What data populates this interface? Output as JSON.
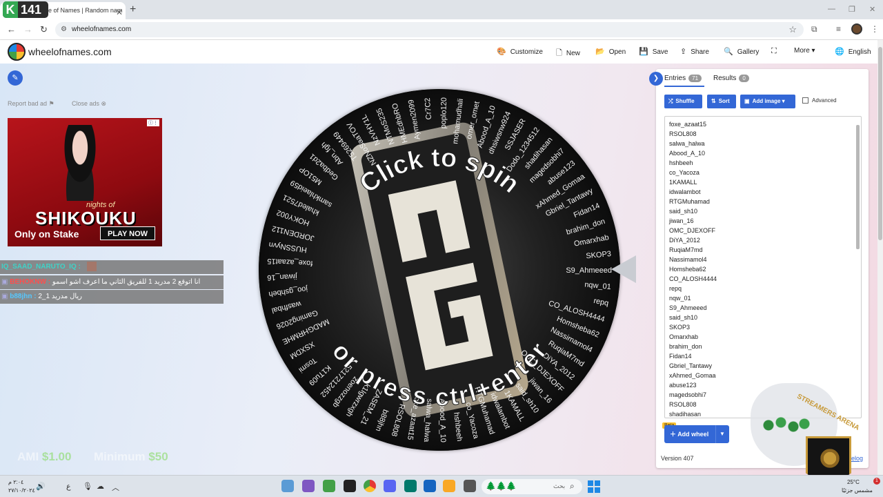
{
  "browser": {
    "overlay_badge": "141",
    "tab_title": "e of Names | Random nam",
    "tab_close": "✕",
    "new_tab": "+",
    "url": "wheelofnames.com",
    "window_controls": [
      "—",
      "❐",
      "✕"
    ]
  },
  "header": {
    "site_name": "wheelofnames.com",
    "menu": [
      {
        "icon": "palette-icon",
        "glyph": "🎨",
        "label": "Customize"
      },
      {
        "icon": "file-icon",
        "glyph": "🗋",
        "label": "New"
      },
      {
        "icon": "folder-icon",
        "glyph": "📂",
        "label": "Open"
      },
      {
        "icon": "floppy-icon",
        "glyph": "💾",
        "label": "Save"
      },
      {
        "icon": "share-icon",
        "glyph": "⇪",
        "label": "Share"
      },
      {
        "icon": "search-icon",
        "glyph": "🔍",
        "label": "Gallery"
      },
      {
        "icon": "fullscreen-icon",
        "glyph": "⛶",
        "label": ""
      },
      {
        "icon": "more-icon",
        "glyph": "",
        "label": "More ▾"
      },
      {
        "icon": "globe-icon",
        "glyph": "🌐",
        "label": "English"
      }
    ]
  },
  "ads": {
    "report_bad_ad": "Report bad ad",
    "close_ads": "Close ads",
    "ad_subtitle": "nights of",
    "ad_title": "SHIKOUKU",
    "ad_only_on": "Only on Stake",
    "ad_play": "PLAY NOW"
  },
  "chat": [
    {
      "user": "IQ_SAAD_NARUTO_IQ :",
      "message": "",
      "user_color": "#3fd3c8"
    },
    {
      "user": "BEHOKNW :",
      "message": "انا اتوقع 2 مدريد 1 للفريق الثاني ما اعرف اشو اسمو",
      "user_color": "#ff4d4d"
    },
    {
      "user": "b88jhn :",
      "message": "ريال مدريد 1_2",
      "user_color": "#55c8ff"
    }
  ],
  "wheel": {
    "spin_text": "Click to spin",
    "press_text": "or press ctrl+enter",
    "logo_text": "PG",
    "labels": [
      "S9_Ahmeeed",
      "nqw_01",
      "repq",
      "CO_ALOSH4444",
      "Homsheba62",
      "Nassimamol4",
      "RuqiaM7md",
      "DiYA_2012",
      "OMC_DJEXOFF",
      "jiwan_16",
      "said_sh10",
      "1KAMALL",
      "idwalambot",
      "RTGMuhamad",
      "co_Yacoza",
      "hshbeeh",
      "Abood_A_10",
      "salwa_halwa",
      "foxe_azaat15",
      "RSOL808",
      "b88jhn",
      "ZASEM_21",
      "k1lgwrzxgh",
      "zoenozzgb",
      "5217212452",
      "K1Tu09",
      "Tosmi",
      "XSXDM",
      "MADGHRMHE",
      "Gaming2026",
      "wasfhbal",
      "joo_gshbeh",
      "jiwan_16",
      "foxe_azaat15",
      "HUSSNyvn",
      "JORDEN112",
      "HOKY002",
      "khaled7521",
      "samkhlaeid59",
      "M51OP",
      "Gedba2d1",
      "Abn_fgh",
      "T5269449",
      "NZNoSaaTOV",
      "NzVHY1L",
      "NTMoS235",
      "HMEdhbRO",
      "Aymen2099",
      "Cr7C2",
      "poplo120",
      "mohamudhali",
      "omer_omet",
      "Abood_A_10",
      "dhsiwsnw924",
      "SSJASER",
      "Dodo_1234512",
      "shadihasan",
      "magedsobhi7",
      "abuse123",
      "xAhmed_Gomaa",
      "Gbriel_Tantawy",
      "Fidan14",
      "brahim_don",
      "Omarxhab",
      "SKOP3"
    ],
    "arrow": "◀"
  },
  "prices": [
    {
      "label": "AMI",
      "value": "$1.00"
    },
    {
      "label": "Minimum",
      "value": "$50"
    }
  ],
  "panel": {
    "tabs": [
      {
        "label": "Entries",
        "count": "71"
      },
      {
        "label": "Results",
        "count": "0"
      }
    ],
    "buttons": {
      "shuffle": "Shuffle",
      "sort": "Sort",
      "add_image": "Add image ▾",
      "advanced": "Advanced"
    },
    "entries": [
      "foxe_azaat15",
      "RSOL808",
      "salwa_halwa",
      "Abood_A_10",
      "hshbeeh",
      "co_Yacoza",
      "1KAMALL",
      "idwalambot",
      "RTGMuhamad",
      "said_sh10",
      "jiwan_16",
      "OMC_DJEXOFF",
      "DiYA_2012",
      "RuqiaM7md",
      "Nassimamol4",
      "Homsheba62",
      "CO_ALOSH4444",
      "repq",
      "nqw_01",
      "S9_Ahmeeed",
      "said_sh10",
      "SKOP3",
      "Omarxhab",
      "brahim_don",
      "Fidan14",
      "Gbriel_Tantawy",
      "xAhmed_Gomaa",
      "abuse123",
      "magedsobhi7",
      "RSOL808",
      "shadihasan"
    ],
    "beta": "Beta",
    "add_wheel": "Add wheel",
    "version": "Version 407",
    "changelog": "elog"
  },
  "stream_overlay": {
    "arena_text": "STREAMERS ARENA"
  },
  "taskbar": {
    "date": "٢٧/١٠/٢٠٢٤",
    "time": "٢:٠٤ م",
    "lang": "ع",
    "search_placeholder": "بحث",
    "weather_temp": "25°C",
    "weather_desc": "مشمس جزئيًا",
    "notif_count": "1"
  },
  "colors": {
    "accent": "#3367d6",
    "price_value": "#7ed957"
  }
}
